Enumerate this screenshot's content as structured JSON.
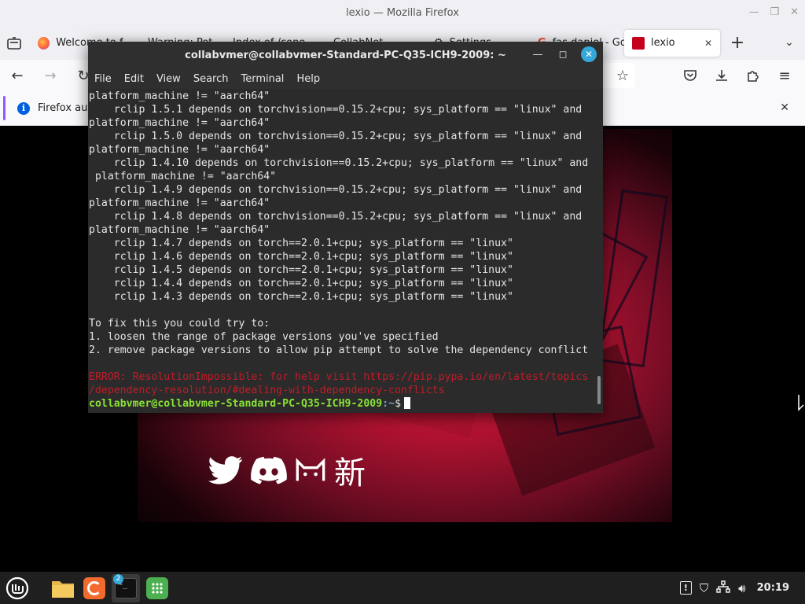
{
  "firefox": {
    "window_title": "lexio — Mozilla Firefox",
    "tabs": [
      {
        "label": "Welcome to f..."
      },
      {
        "label": "Warning: Pot..."
      },
      {
        "label": "Index of /cone..."
      },
      {
        "label": "CollabNet..."
      },
      {
        "label": "Settings"
      },
      {
        "label": "fas daniel - Go"
      },
      {
        "label": "lexio",
        "active": true
      }
    ],
    "notification": {
      "text": "Firefox aut"
    }
  },
  "terminal": {
    "title": "collabvmer@collabvmer-Standard-PC-Q35-ICH9-2009: ~",
    "menu": [
      "File",
      "Edit",
      "View",
      "Search",
      "Terminal",
      "Help"
    ],
    "lines": [
      "platform_machine != \"aarch64\"",
      "    rclip 1.5.1 depends on torchvision==0.15.2+cpu; sys_platform == \"linux\" and",
      "platform_machine != \"aarch64\"",
      "    rclip 1.5.0 depends on torchvision==0.15.2+cpu; sys_platform == \"linux\" and",
      "platform_machine != \"aarch64\"",
      "    rclip 1.4.10 depends on torchvision==0.15.2+cpu; sys_platform == \"linux\" and",
      " platform_machine != \"aarch64\"",
      "    rclip 1.4.9 depends on torchvision==0.15.2+cpu; sys_platform == \"linux\" and",
      "platform_machine != \"aarch64\"",
      "    rclip 1.4.8 depends on torchvision==0.15.2+cpu; sys_platform == \"linux\" and",
      "platform_machine != \"aarch64\"",
      "    rclip 1.4.7 depends on torch==2.0.1+cpu; sys_platform == \"linux\"",
      "    rclip 1.4.6 depends on torch==2.0.1+cpu; sys_platform == \"linux\"",
      "    rclip 1.4.5 depends on torch==2.0.1+cpu; sys_platform == \"linux\"",
      "    rclip 1.4.4 depends on torch==2.0.1+cpu; sys_platform == \"linux\"",
      "    rclip 1.4.3 depends on torch==2.0.1+cpu; sys_platform == \"linux\"",
      "",
      "To fix this you could try to:",
      "1. loosen the range of package versions you've specified",
      "2. remove package versions to allow pip attempt to solve the dependency conflict",
      ""
    ],
    "error_lines": [
      "ERROR: ResolutionImpossible: for help visit https://pip.pypa.io/en/latest/topics",
      "/dependency-resolution/#dealing-with-dependency-conflicts"
    ],
    "prompt_user": "collabvmer@collabvmer-Standard-PC-Q35-ICH9-2009",
    "prompt_path": ":~",
    "prompt_symbol": "$"
  },
  "page": {
    "social_char": "新"
  },
  "taskbar": {
    "terminal_badge": "2",
    "clock": "20:19"
  },
  "colors": {
    "prompt_green": "#8ae234",
    "error_red": "#c01c28",
    "terminal_bg": "#2b2b2b",
    "close_button_blue": "#35a7d9"
  }
}
